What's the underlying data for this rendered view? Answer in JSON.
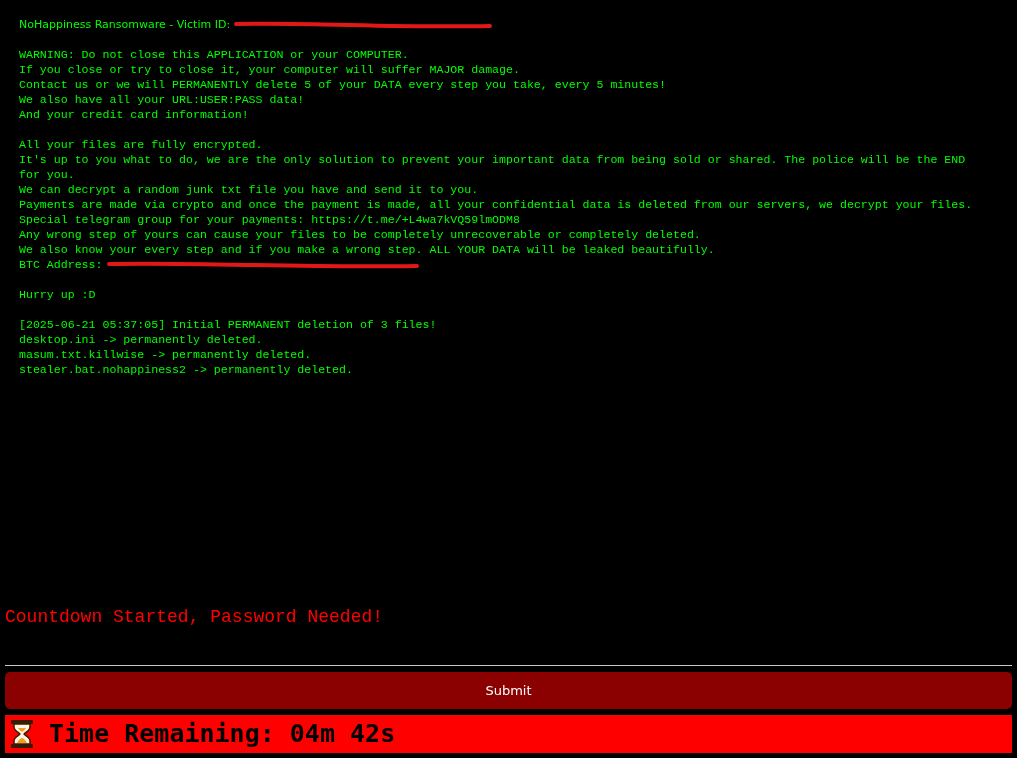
{
  "header": {
    "text": "NoHappiness Ransomware - Victim ID:",
    "redacted": true
  },
  "paragraphs": [
    [
      {
        "text": "WARNING: Do not close this APPLICATION or your COMPUTER.",
        "redacted": false
      },
      {
        "text": "If you close or try to close it, your computer will suffer MAJOR damage.",
        "redacted": false
      },
      {
        "text": "Contact us or we will PERMANENTLY delete 5 of your DATA every step you take, every 5 minutes!",
        "redacted": false
      },
      {
        "text": "We also have all your URL:USER:PASS data!",
        "redacted": false
      },
      {
        "text": "And your credit card information!",
        "redacted": false
      }
    ],
    [
      {
        "text": "All your files are fully encrypted.",
        "redacted": false
      },
      {
        "text": "It's up to you what to do, we are the only solution to prevent your important data from being sold or shared. The police will be the END for you.",
        "redacted": false
      },
      {
        "text": "We can decrypt a random junk txt file you have and send it to you.",
        "redacted": false
      },
      {
        "text": "Payments are made via crypto and once the payment is made, all your confidential data is deleted from our servers, we decrypt your files.",
        "redacted": false
      },
      {
        "text": "Special telegram group for your payments: https://t.me/+L4wa7kVQ59lmODM8",
        "redacted": false
      },
      {
        "text": "Any wrong step of yours can cause your files to be completely unrecoverable or completely deleted.",
        "redacted": false
      },
      {
        "text": "We also know your every step and if you make a wrong step. ALL YOUR DATA will be leaked beautifully.",
        "redacted": false
      },
      {
        "text": "BTC Address:",
        "redacted": true
      }
    ],
    [
      {
        "text": "Hurry up :D",
        "redacted": false
      }
    ],
    [
      {
        "text": "[2025-06-21 05:37:05] Initial PERMANENT deletion of 3 files!",
        "redacted": false
      },
      {
        "text": "desktop.ini -> permanently deleted.",
        "redacted": false
      },
      {
        "text": "masum.txt.killwise -> permanently deleted.",
        "redacted": false
      },
      {
        "text": "stealer.bat.nohappiness2 -> permanently deleted.",
        "redacted": false
      }
    ]
  ],
  "status": "Countdown Started, Password Needed!",
  "submit": "Submit",
  "timer": "Time Remaining: 04m 42s"
}
